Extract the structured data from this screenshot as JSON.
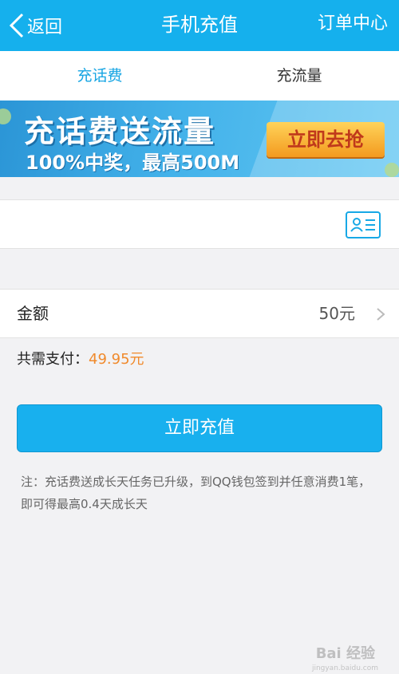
{
  "header": {
    "back_label": "返回",
    "title": "手机充值",
    "order_center": "订单中心"
  },
  "tabs": [
    {
      "label": "充话费",
      "active": true
    },
    {
      "label": "充流量",
      "active": false
    }
  ],
  "banner": {
    "title": "充话费送流量",
    "subtitle": "100%中奖，最高500M",
    "cta": "立即去抢"
  },
  "phone": {
    "value": "",
    "carrier": ""
  },
  "amount": {
    "label": "金额",
    "value": "50元"
  },
  "payment": {
    "label": "共需支付：",
    "value": "49.95元"
  },
  "recharge_button": "立即充值",
  "note": "注：充话费送成长天任务已升级，到QQ钱包签到并任意消费1笔，即可得最高0.4天成长天",
  "watermark": {
    "text": "Bai 经验",
    "sub": "jingyan.baidu.com"
  },
  "colors": {
    "header_bg": "#15b0ed",
    "accent": "#16a5e3",
    "price": "#f08a2c",
    "button": "#18b0ee"
  }
}
